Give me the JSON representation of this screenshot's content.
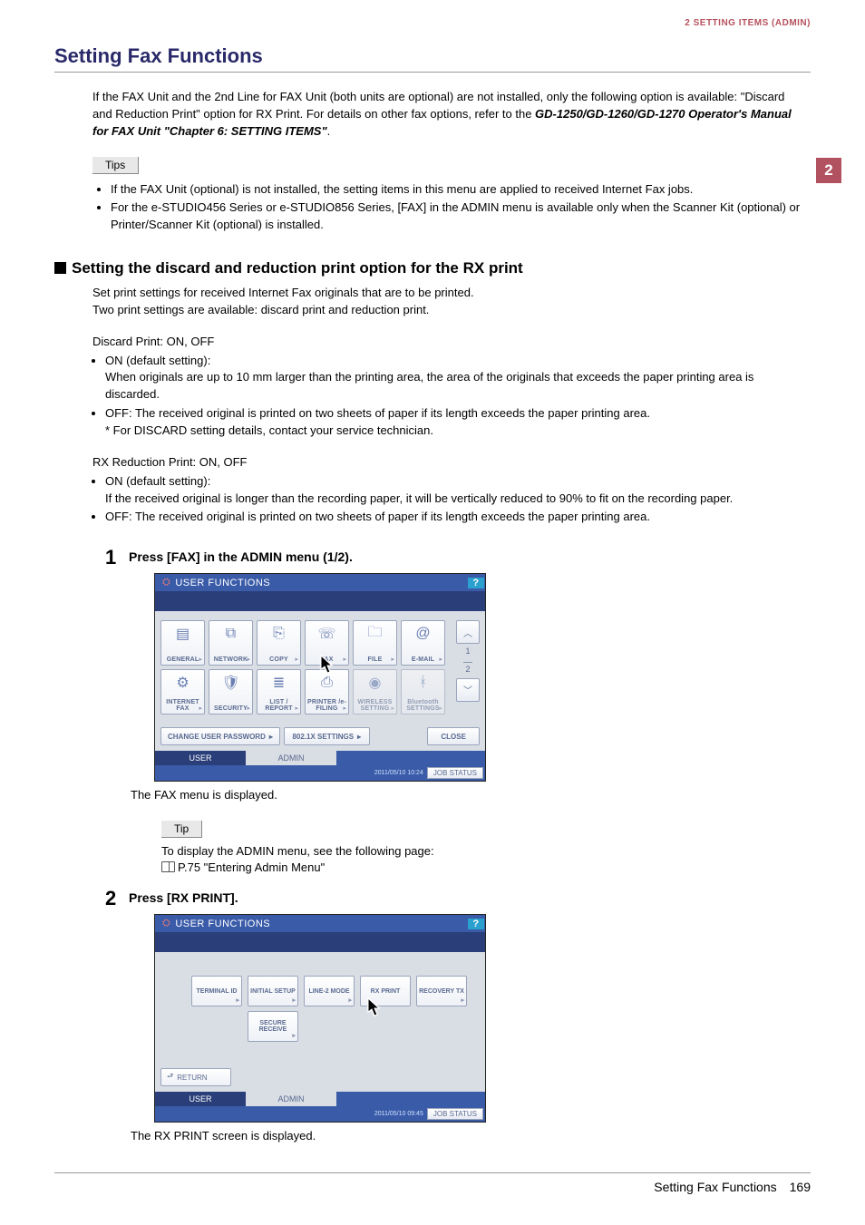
{
  "header": {
    "breadcrumb": "2 SETTING ITEMS (ADMIN)"
  },
  "side_tab": "2",
  "title": "Setting Fax Functions",
  "intro": {
    "text1": "If the FAX Unit and the 2nd Line for FAX Unit (both units are optional) are not installed, only the following option is available: \"Discard and Reduction Print\" option for RX Print. For details on other fax options, refer to the ",
    "bold_ref": "GD-1250/GD-1260/GD-1270 Operator's Manual for FAX Unit \"Chapter 6: SETTING ITEMS\"",
    "text2": "."
  },
  "tips_label": "Tips",
  "tips": [
    "If the FAX Unit (optional) is not installed, the setting items in this menu are applied to received Internet Fax jobs.",
    "For the e-STUDIO456 Series or e-STUDIO856 Series, [FAX] in the ADMIN menu is available only when the Scanner Kit (optional) or Printer/Scanner Kit (optional) is installed."
  ],
  "section_title": "Setting the discard and reduction print option for the RX print",
  "section_intro": [
    "Set print settings for received Internet Fax originals that are to be printed.",
    "Two print settings are available: discard print and reduction print."
  ],
  "discard_heading": "Discard Print: ON, OFF",
  "discard_items": [
    {
      "head": "ON (default setting):",
      "body": "When originals are up to 10 mm larger than the printing area, the area of the originals that exceeds the paper printing area is discarded."
    },
    {
      "head": "OFF: The received original is printed on two sheets of paper if its length exceeds the paper printing area.",
      "body": "* For DISCARD setting details, contact your service technician."
    }
  ],
  "rx_heading": "RX Reduction Print: ON, OFF",
  "rx_items": [
    {
      "head": "ON (default setting):",
      "body": "If the received original is longer than the recording paper, it will be vertically reduced to 90% to fit on the recording paper."
    },
    {
      "head": "OFF: The received original is printed on two sheets of paper if its length exceeds the paper printing area.",
      "body": ""
    }
  ],
  "step1": {
    "num": "1",
    "text": "Press [FAX] in the ADMIN menu (1/2).",
    "caption": "The FAX menu is displayed."
  },
  "tip_label": "Tip",
  "tip_text": "To display the ADMIN menu, see the following page:",
  "tip_ref": "P.75 \"Entering Admin Menu\"",
  "step2": {
    "num": "2",
    "text": "Press [RX PRINT].",
    "caption": "The RX PRINT screen is displayed."
  },
  "panel": {
    "title": "USER FUNCTIONS",
    "help": "?",
    "page_indicator_top": "1",
    "page_indicator_bottom": "2",
    "tiles": [
      "GENERAL",
      "NETWORK",
      "COPY",
      "FAX",
      "FILE",
      "E-MAIL",
      "INTERNET FAX",
      "SECURITY",
      "LIST / REPORT",
      "PRINTER /e-FILING",
      "WIRELESS SETTING",
      "Bluetooth SETTINGS"
    ],
    "bottom_buttons": [
      "CHANGE USER PASSWORD",
      "802.1X SETTINGS",
      "CLOSE"
    ],
    "tabs": [
      "USER",
      "ADMIN"
    ],
    "timestamp": "2011/05/10 10:24",
    "job_status": "JOB STATUS"
  },
  "panel2": {
    "tiles_row1": [
      "TERMINAL ID",
      "INITIAL SETUP",
      "LINE-2 MODE",
      "RX PRINT",
      "RECOVERY TX"
    ],
    "tiles_row2": [
      "SECURE RECEIVE"
    ],
    "return": "RETURN",
    "timestamp": "2011/05/10 09:45"
  },
  "footer": {
    "label": "Setting Fax Functions",
    "page": "169"
  }
}
